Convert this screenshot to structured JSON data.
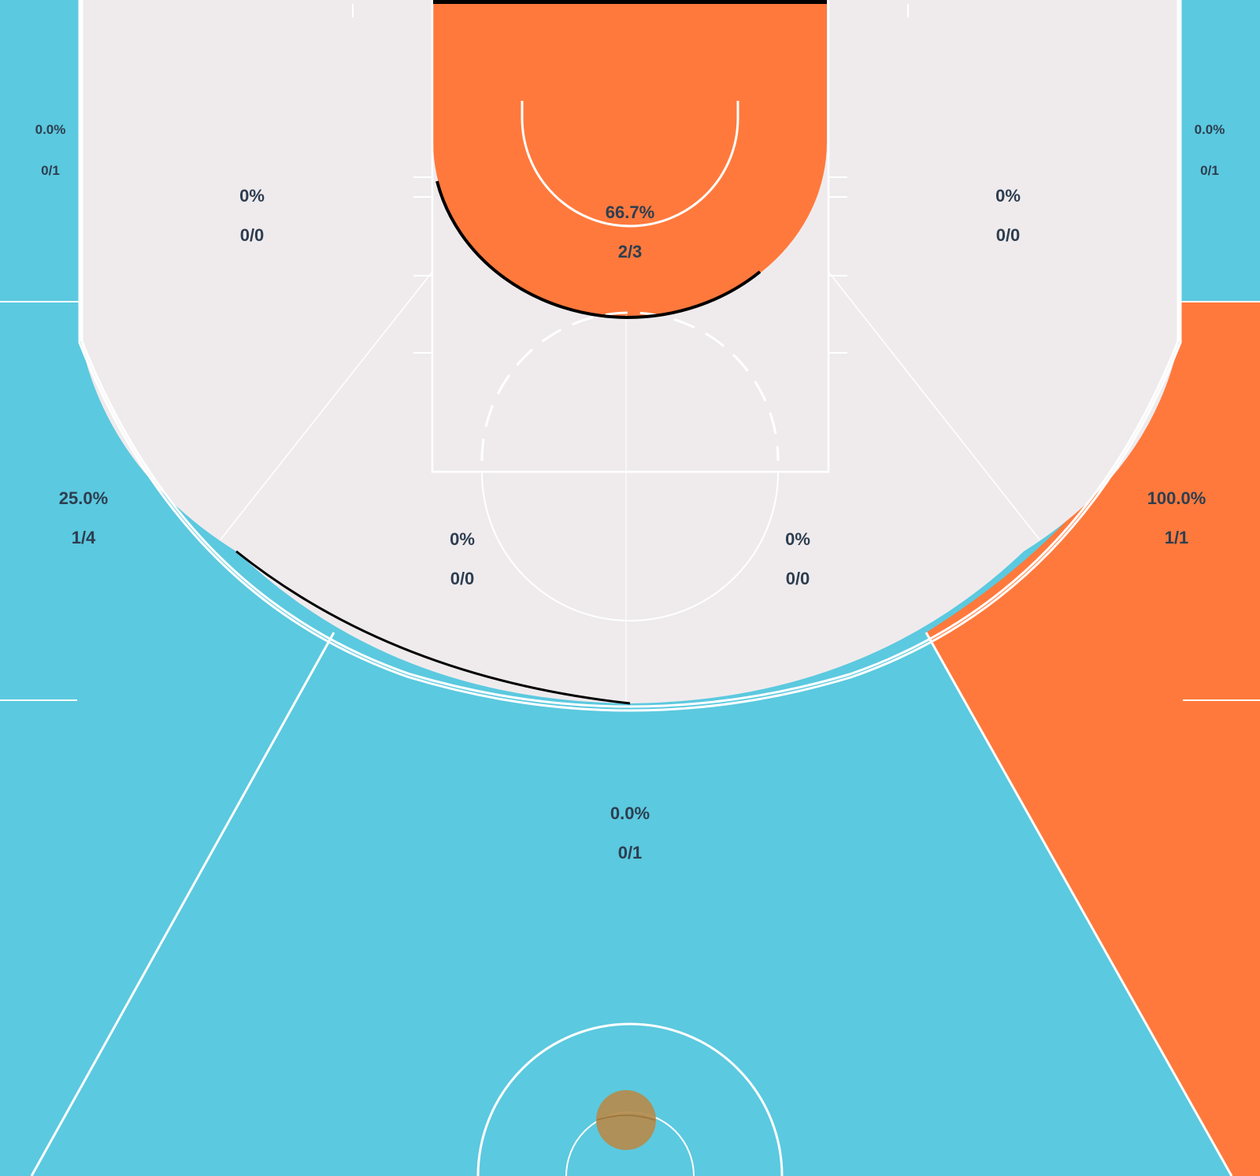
{
  "colors": {
    "cold": "#5bc9df",
    "hot": "#ff793c",
    "neutral": "#efebed",
    "label": "#2d3e50",
    "line": "#ffffff",
    "ball": "#b58b4c"
  },
  "chart_data": {
    "type": "heatmap",
    "title": "",
    "zones": [
      {
        "id": "restricted-area",
        "pct": "66.7%",
        "made_attempts": "2/3",
        "heat": "hot"
      },
      {
        "id": "mid-left-baseline",
        "pct": "0%",
        "made_attempts": "0/0",
        "heat": "neutral"
      },
      {
        "id": "mid-right-baseline",
        "pct": "0%",
        "made_attempts": "0/0",
        "heat": "neutral"
      },
      {
        "id": "mid-left-elbow",
        "pct": "0%",
        "made_attempts": "0/0",
        "heat": "neutral"
      },
      {
        "id": "mid-right-elbow",
        "pct": "0%",
        "made_attempts": "0/0",
        "heat": "neutral"
      },
      {
        "id": "left-corner-three",
        "pct": "0.0%",
        "made_attempts": "0/1",
        "heat": "cold"
      },
      {
        "id": "right-corner-three",
        "pct": "0.0%",
        "made_attempts": "0/1",
        "heat": "cold"
      },
      {
        "id": "left-wing-three",
        "pct": "25.0%",
        "made_attempts": "1/4",
        "heat": "cold"
      },
      {
        "id": "right-wing-three",
        "pct": "100.0%",
        "made_attempts": "1/1",
        "heat": "hot"
      },
      {
        "id": "top-of-key-three",
        "pct": "0.0%",
        "made_attempts": "0/1",
        "heat": "cold"
      }
    ]
  }
}
